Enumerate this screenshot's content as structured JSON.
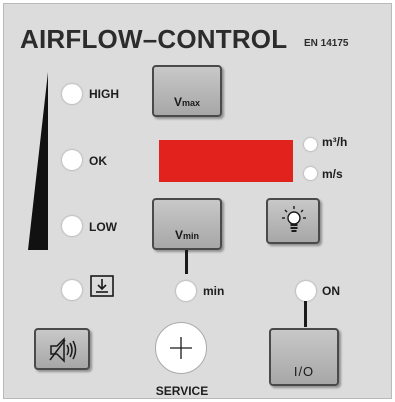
{
  "header": {
    "title": "AIRFLOW–CONTROL",
    "standard": "EN 14175"
  },
  "indicators": {
    "high_label": "HIGH",
    "ok_label": "OK",
    "low_label": "LOW",
    "min_label": "min",
    "on_label": "ON"
  },
  "display": {
    "unit_flow": "m³/h",
    "unit_velocity": "m/s",
    "color": "#e2221c"
  },
  "buttons": {
    "vmax_main": "V",
    "vmax_sub": "max",
    "vmin_main": "V",
    "vmin_sub": "min",
    "io_label": "I/O",
    "service_label": "SERVICE"
  },
  "icons": {
    "light": "light-bulb-icon",
    "mute": "speaker-mute-icon",
    "service": "plus-icon",
    "sash": "sash-down-icon"
  }
}
